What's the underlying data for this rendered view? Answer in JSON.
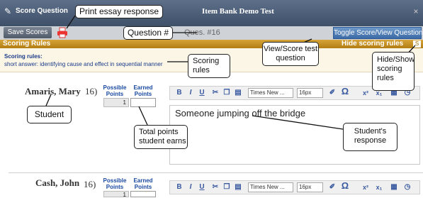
{
  "title_bar": {
    "title": "Score Question",
    "test_name": "Item Bank Demo Test",
    "close_glyph": "×"
  },
  "toolbar": {
    "save_label": "Save Scores",
    "question_number": "Ques. #16",
    "toggle_label": "Toggle Score/View Question"
  },
  "scoring_rules": {
    "bar_label": "Scoring Rules",
    "hide_label": "Hide scoring rules",
    "heading": "Scoring rules:",
    "text": "short answer: identifying cause and effect in sequential manner"
  },
  "students": [
    {
      "name": "Amaris, Mary",
      "question": "16)",
      "possible_header": "Possible Points",
      "earned_header": "Earned Points",
      "possible_value": "1",
      "response": "Someone jumping off the bridge"
    },
    {
      "name": "Cash, John",
      "question": "16)",
      "possible_header": "Possible Points",
      "earned_header": "Earned Points",
      "possible_value": "1"
    }
  ],
  "editor": {
    "bold": "B",
    "italic": "I",
    "underline": "U",
    "font_family": "Times New ...",
    "font_size": "16px",
    "omega": "Ω",
    "superscript": "x²",
    "subscript": "x₁"
  },
  "callouts": {
    "print": "Print essay response",
    "question": "Question #",
    "view_score": "View/Score test question",
    "rules": "Scoring rules",
    "hide_show": "Hide/Show scoring rules",
    "student": "Student",
    "total_points": "Total points student earns",
    "response": "Student's response"
  },
  "icons": {
    "title": "pen-icon",
    "print": "print-icon",
    "hide": "hide-rules-icon",
    "cut": "cut-icon",
    "copy": "copy-icon",
    "paste": "paste-icon",
    "eraser": "eraser-icon",
    "table": "table-icon",
    "clock": "clock-icon"
  },
  "colors": {
    "title_bar": "#4a5b75",
    "rules_bar": "#c48d22",
    "toggle_button": "#4f7fba",
    "save_button": "#646d7b"
  }
}
